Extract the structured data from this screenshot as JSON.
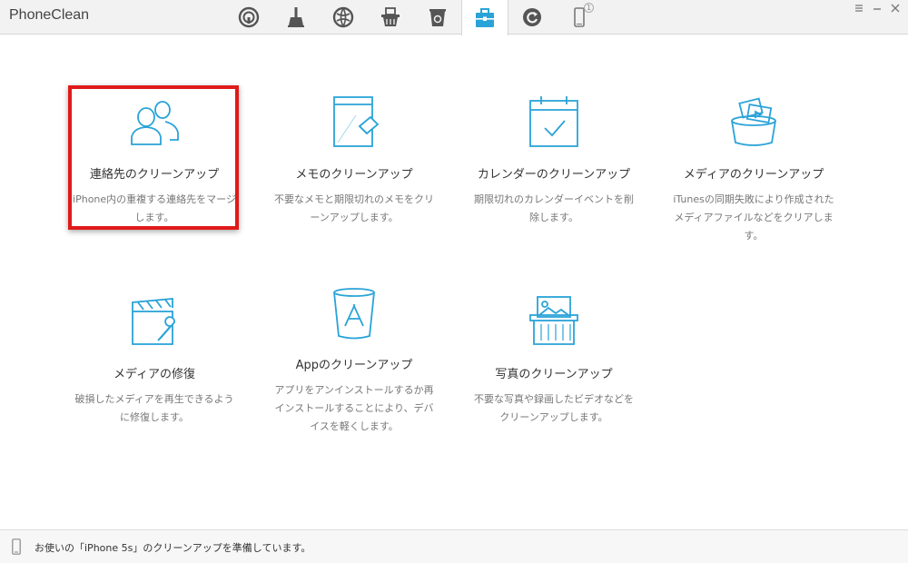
{
  "app": {
    "title": "PhoneClean"
  },
  "toolbar": {
    "tools": [
      {
        "icon": "privacy-icon"
      },
      {
        "icon": "broom-icon"
      },
      {
        "icon": "internet-icon"
      },
      {
        "icon": "basket-icon"
      },
      {
        "icon": "trash-icon"
      },
      {
        "icon": "toolbox-icon",
        "active": true
      },
      {
        "icon": "refresh-icon"
      },
      {
        "icon": "phone-icon",
        "badge": "1"
      }
    ]
  },
  "cards": [
    {
      "icon": "contacts-icon",
      "title": "連絡先のクリーンアップ",
      "desc": "iPhone内の重複する連絡先をマージします。"
    },
    {
      "icon": "memo-eraser-icon",
      "title": "メモのクリーンアップ",
      "desc": "不要なメモと期限切れのメモをクリーンアップします。"
    },
    {
      "icon": "calendar-icon",
      "title": "カレンダーのクリーンアップ",
      "desc": "期限切れのカレンダーイベントを削除します。"
    },
    {
      "icon": "media-bucket-icon",
      "title": "メディアのクリーンアップ",
      "desc": "iTunesの同期失敗により作成されたメディアファイルなどをクリアします。"
    },
    {
      "icon": "media-repair-icon",
      "title": "メディアの修復",
      "desc": "破損したメディアを再生できるように修復します。"
    },
    {
      "icon": "app-bucket-icon",
      "title": "Appのクリーンアップ",
      "desc": "アプリをアンインストールするか再インストールすることにより、デバイスを軽くします。"
    },
    {
      "icon": "photo-shredder-icon",
      "title": "写真のクリーンアップ",
      "desc": "不要な写真や録画したビデオなどをクリーンアップします。"
    }
  ],
  "status": {
    "text": "お使いの「iPhone 5s」のクリーンアップを準備しています。"
  },
  "colors": {
    "accent": "#2aa3d8",
    "highlight": "#e01a1a"
  }
}
